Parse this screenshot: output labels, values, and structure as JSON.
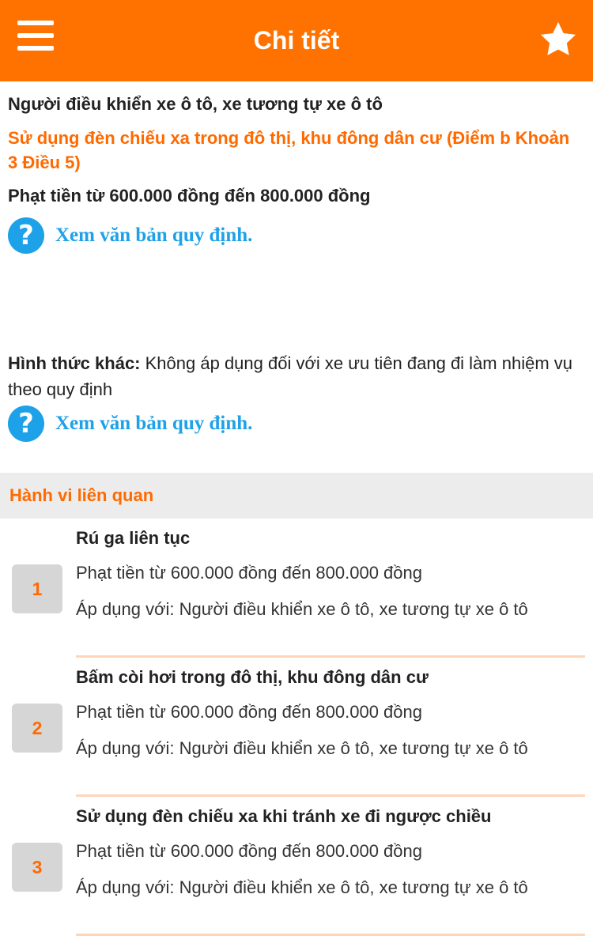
{
  "header": {
    "title": "Chi tiết"
  },
  "detail": {
    "subject": "Người điều khiển xe ô tô, xe tương tự xe ô tô",
    "violation": "Sử dụng đèn chiếu xa trong đô thị, khu đông dân cư (Điểm b Khoản 3 Điều 5)",
    "fine": "Phạt tiền từ 600.000 đồng đến 800.000 đồng",
    "link_text": "Xem văn bản quy định.",
    "other_label": "Hình thức khác:",
    "other_text": " Không áp dụng đối với xe ưu tiên đang đi làm nhiệm vụ theo quy định"
  },
  "related": {
    "title": "Hành vi liên quan",
    "items": [
      {
        "num": "1",
        "name": "Rú ga liên tục",
        "fine": "Phạt tiền từ 600.000 đồng đến 800.000 đồng",
        "apply": "Áp dụng với: Người điều khiển xe ô tô, xe tương tự xe ô tô"
      },
      {
        "num": "2",
        "name": "Bấm còi hơi trong đô thị, khu đông dân cư",
        "fine": "Phạt tiền từ 600.000 đồng đến 800.000 đồng",
        "apply": "Áp dụng với: Người điều khiển xe ô tô, xe tương tự xe ô tô"
      },
      {
        "num": "3",
        "name": "Sử dụng đèn chiếu xa khi tránh xe đi ngược chiều",
        "fine": "Phạt tiền từ 600.000 đồng đến 800.000 đồng",
        "apply": "Áp dụng với: Người điều khiển xe ô tô, xe tương tự xe ô tô"
      }
    ]
  },
  "colors": {
    "accent": "#ff7200",
    "link": "#1da1e8"
  }
}
